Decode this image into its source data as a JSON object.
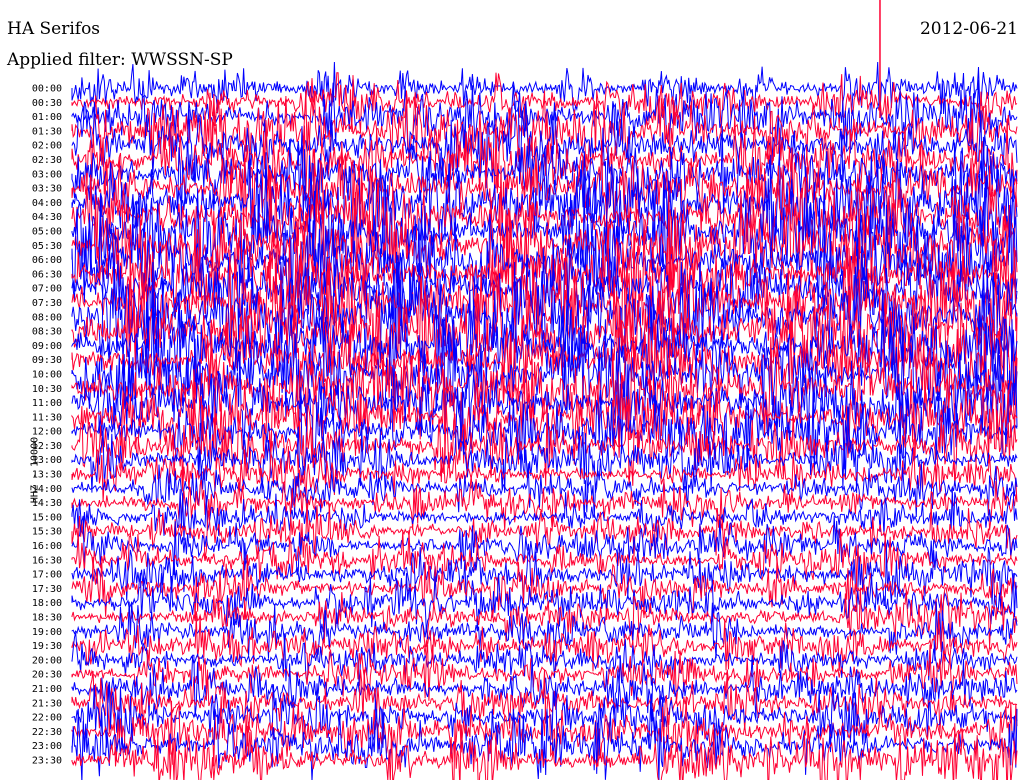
{
  "header": {
    "station": "HA Serifos",
    "date": "2012-06-21",
    "filter_label": "Applied filter: WWSSN-SP"
  },
  "y_side_label": "HHZ - 10000",
  "colors": {
    "trace_a": "#0000ff",
    "trace_b": "#ff0033"
  },
  "chart_data": {
    "type": "line",
    "title": "HA Serifos",
    "subtitle": "Applied filter: WWSSN-SP",
    "date": "2012-06-21",
    "ylabel": "HHZ - 10000",
    "xlabel": "",
    "rows": [
      "00:00",
      "00:30",
      "01:00",
      "01:30",
      "02:00",
      "02:30",
      "03:00",
      "03:30",
      "04:00",
      "04:30",
      "05:00",
      "05:30",
      "06:00",
      "06:30",
      "07:00",
      "07:30",
      "08:00",
      "08:30",
      "09:00",
      "09:30",
      "10:00",
      "10:30",
      "11:00",
      "11:30",
      "12:00",
      "12:30",
      "13:00",
      "13:30",
      "14:00",
      "14:30",
      "15:00",
      "15:30",
      "16:00",
      "16:30",
      "17:00",
      "17:30",
      "18:00",
      "18:30",
      "19:00",
      "19:30",
      "20:00",
      "20:30",
      "21:00",
      "21:30",
      "22:00",
      "22:30",
      "23:00",
      "23:30"
    ],
    "row_colors": [
      "blue",
      "red"
    ],
    "activity": [
      0.5,
      0.6,
      0.8,
      0.9,
      1.0,
      1.0,
      1.1,
      1.1,
      1.2,
      1.2,
      1.3,
      1.3,
      1.3,
      1.3,
      1.3,
      1.3,
      1.3,
      1.3,
      1.3,
      1.3,
      1.3,
      1.2,
      1.2,
      1.1,
      1.0,
      0.9,
      0.7,
      0.55,
      0.6,
      0.55,
      0.55,
      0.55,
      0.6,
      0.6,
      0.65,
      0.65,
      0.6,
      0.6,
      0.6,
      0.6,
      0.55,
      0.6,
      0.7,
      0.7,
      0.75,
      0.75,
      0.8,
      0.8
    ],
    "events": [
      {
        "row": "00:00",
        "time_fraction": 0.855,
        "label": ""
      }
    ],
    "legend": "none",
    "grid": false
  }
}
